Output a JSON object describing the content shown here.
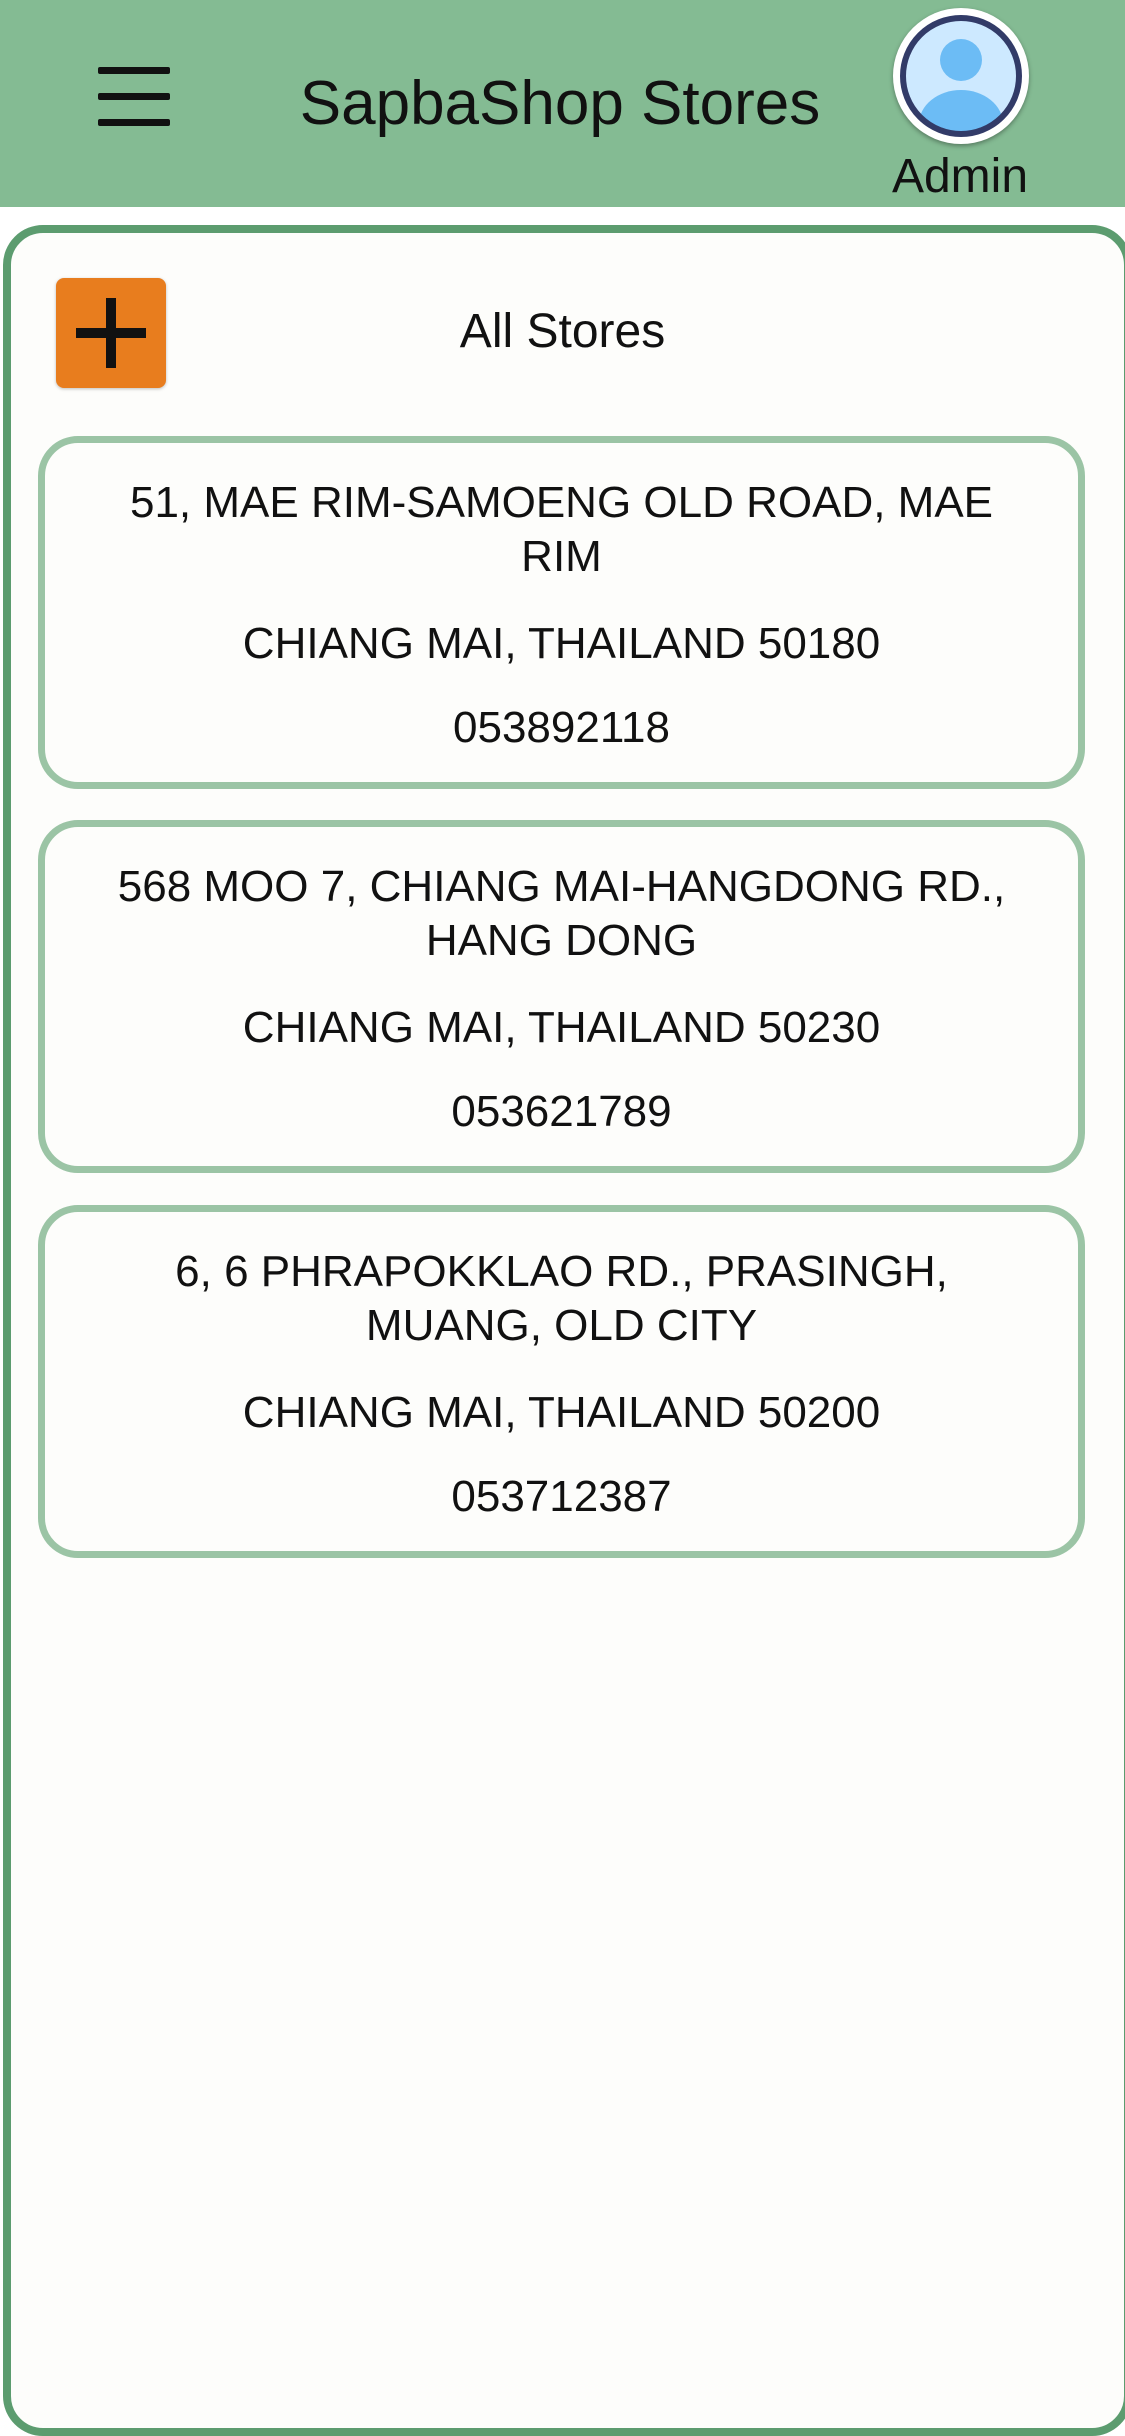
{
  "header": {
    "title": "SapbaShop Stores",
    "user_label": "Admin",
    "menu_icon": "hamburger-menu-icon",
    "avatar_icon": "user-avatar-icon"
  },
  "colors": {
    "header_bg": "#84bb93",
    "panel_border": "#5c9c6f",
    "card_border": "#9bc4a5",
    "add_button": "#e87d1e",
    "avatar_fill": "#cde9ff",
    "avatar_figure": "#6cbcf5",
    "avatar_ring": "#323b68"
  },
  "main": {
    "section_title": "All Stores",
    "add_icon": "plus-icon",
    "stores": [
      {
        "address_line1": "51, MAE RIM-SAMOENG OLD ROAD, MAE RIM",
        "address_line2": "CHIANG MAI, THAILAND 50180",
        "phone": "053892118"
      },
      {
        "address_line1": "568 MOO 7, CHIANG MAI-HANGDONG RD., HANG DONG",
        "address_line2": "CHIANG MAI, THAILAND 50230",
        "phone": "053621789"
      },
      {
        "address_line1": "6, 6 PHRAPOKKLAO RD., PRASINGH, MUANG, OLD CITY",
        "address_line2": "CHIANG MAI, THAILAND 50200",
        "phone": "053712387"
      }
    ]
  }
}
